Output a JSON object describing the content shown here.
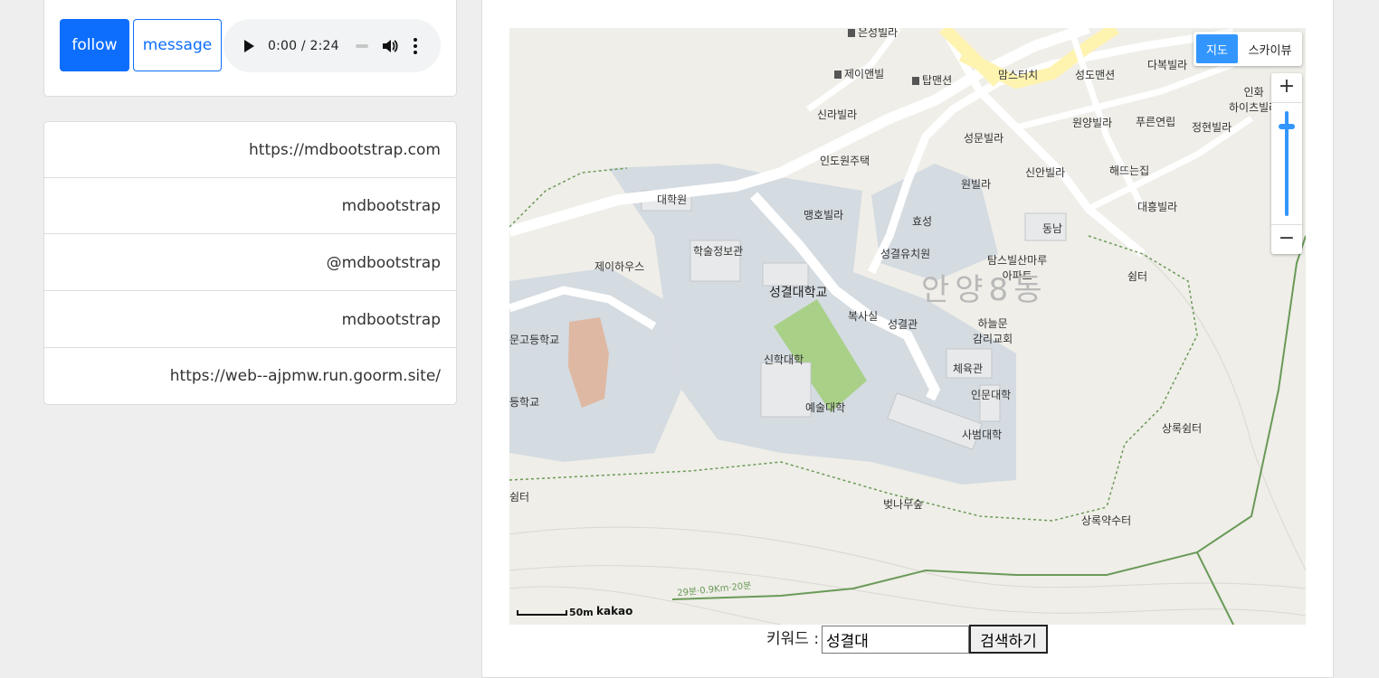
{
  "profile": {
    "follow_label": "follow",
    "message_label": "message",
    "audio": {
      "time": "0:00 / 2:24"
    }
  },
  "links": [
    "https://mdbootstrap.com",
    "mdbootstrap",
    "@mdbootstrap",
    "mdbootstrap",
    "https://web--ajpmw.run.goorm.site/"
  ],
  "map": {
    "maptype": {
      "selected": "지도",
      "other": "스카이뷰"
    },
    "zoom": {
      "in": "+",
      "out": "−"
    },
    "scale": {
      "label": "50m",
      "logo": "kakao"
    },
    "labels": {
      "l1": "은성빌라",
      "l2": "제이앤빌",
      "l3": "탑맨션",
      "l4": "맘스터치",
      "l5": "성도맨션",
      "l6": "다복빌라",
      "l7": "인화\n하이츠빌라",
      "l8": "신라빌라",
      "l9": "원양빌라",
      "l10": "푸른연립",
      "l11": "정현빌라",
      "l12": "성문빌라",
      "l13": "인도원주택",
      "l14": "신안빌라",
      "l15": "해뜨는집",
      "l16": "원빌라",
      "l17": "대학원",
      "l18": "맹호빌라",
      "l19": "효성",
      "l20": "대흥빌라",
      "l21": "동남",
      "l22": "학술정보관",
      "l23": "성결유치원",
      "l24": "제이하우스",
      "l25": "탐스빌산마루\n아파트",
      "l26": "쉼터",
      "l27": "성결대학교",
      "l28": "안양8동",
      "l29": "복사실",
      "l30": "성결관",
      "l31": "하늘문\n감리교회",
      "l32": "문고등학교",
      "l33": "신학대학",
      "l34": "체육관",
      "l35": "인문대학",
      "l36": "등학교",
      "l37": "예술대학",
      "l38": "사범대학",
      "l39": "상록쉼터",
      "l40": "벚나무숲",
      "l41": "상록약수터",
      "l42": "쉼터",
      "l43": "29분·0.9Km·20분"
    }
  },
  "search": {
    "label": "키워드 :",
    "value": "성결대",
    "button": "검색하기"
  },
  "colors": {
    "primary": "#0d6efd",
    "map_accent": "#3396ff"
  }
}
